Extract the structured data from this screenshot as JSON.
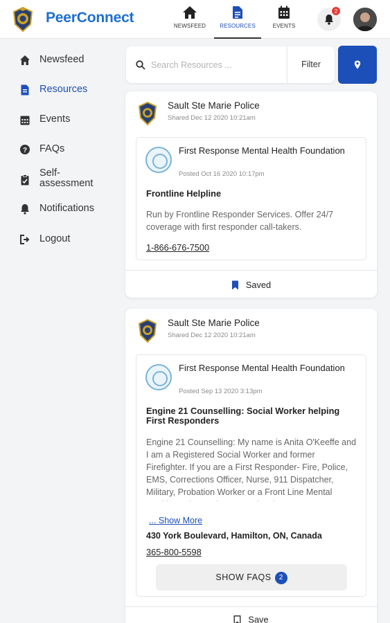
{
  "app": {
    "name": "PeerConnect",
    "accent_color": "#1d4fb8",
    "brand_color": "#1d6fd1"
  },
  "topnav": {
    "tabs": [
      {
        "label": "NEWSFEED",
        "icon": "home-icon"
      },
      {
        "label": "RESOURCES",
        "icon": "document-icon",
        "active": true
      },
      {
        "label": "EVENTS",
        "icon": "calendar-icon"
      }
    ],
    "notification_count": "2"
  },
  "sidebar": {
    "items": [
      {
        "label": "Newsfeed",
        "icon": "home-icon"
      },
      {
        "label": "Resources",
        "icon": "document-icon",
        "active": true
      },
      {
        "label": "Events",
        "icon": "calendar-icon"
      },
      {
        "label": "FAQs",
        "icon": "question-icon"
      },
      {
        "label": "Self-assessment",
        "icon": "clipboard-icon"
      },
      {
        "label": "Notifications",
        "icon": "bell-icon"
      },
      {
        "label": "Logout",
        "icon": "logout-icon"
      }
    ]
  },
  "search": {
    "placeholder": "Search Resources ...",
    "filter_label": "Filter"
  },
  "cards": [
    {
      "poster": "Sault Ste Marie Police",
      "shared": "Shared Dec 12 2020 10:21am",
      "org": "First Response Mental Health Foundation",
      "posted": "Posted Oct 16 2020 10:17pm",
      "title": "Frontline Helpline",
      "description": "Run by Frontline Responder Services. Offer 24/7 coverage with first responder call-takers.",
      "phone": "1-866-676-7500",
      "footer_label": "Saved"
    },
    {
      "poster": "Sault Ste Marie Police",
      "shared": "Shared Dec 12 2020 10:21am",
      "org": "First Response Mental Health Foundation",
      "posted": "Posted Sep 13 2020 3:13pm",
      "title": "Engine 21 Counselling: Social Worker helping First Responders",
      "description": "Engine 21 Counselling: My name is Anita O'Keeffe and I am a Registered Social Worker and former Firefighter. If you are a First Responder- Fire, Police, EMS, Corrections Officer, Nurse, 911 Dispatcher, Military, Probation Worker or a Front Line Mental Health Worker and are experiencing",
      "show_more": "... Show More",
      "address": "430 York Boulevard, Hamilton, ON, Canada",
      "phone": "365-800-5598",
      "faq_label": "SHOW FAQS",
      "faq_count": "2",
      "footer_label": "Save"
    }
  ]
}
